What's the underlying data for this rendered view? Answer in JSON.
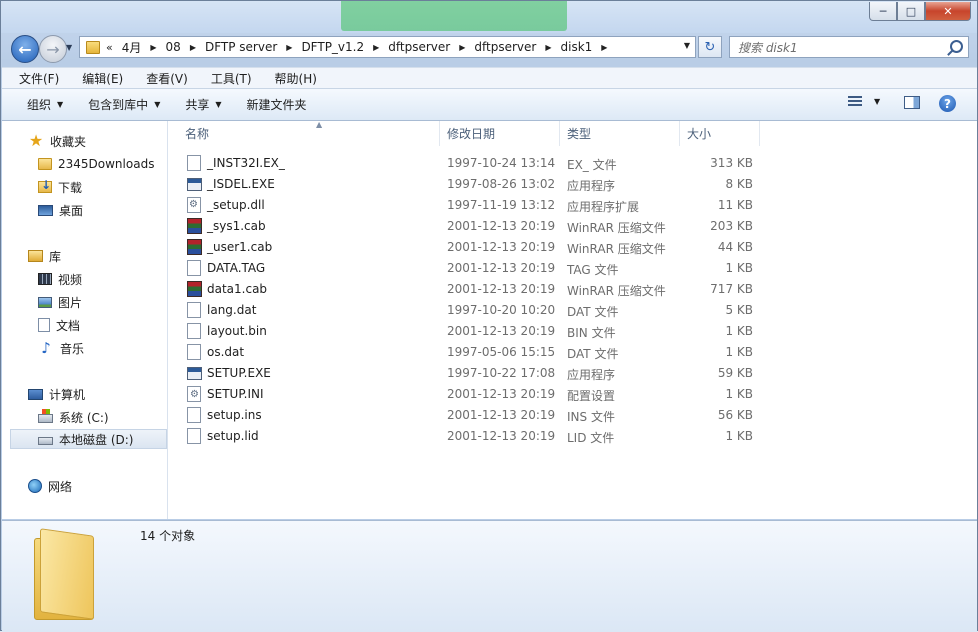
{
  "window": {
    "controls": {
      "minimize": "─",
      "maximize": "□",
      "close": "✕"
    }
  },
  "nav": {
    "breadcrumb": [
      "«",
      "4月",
      "08",
      "DFTP server",
      "DFTP_v1.2",
      "dftpserver",
      "dftpserver",
      "disk1"
    ],
    "search_placeholder": "搜索 disk1"
  },
  "menu": [
    "文件(F)",
    "编辑(E)",
    "查看(V)",
    "工具(T)",
    "帮助(H)"
  ],
  "commands": [
    {
      "label": "组织",
      "dropdown": true
    },
    {
      "label": "包含到库中",
      "dropdown": true
    },
    {
      "label": "共享",
      "dropdown": true
    },
    {
      "label": "新建文件夹",
      "dropdown": false
    }
  ],
  "sidebar": {
    "favorites": {
      "label": "收藏夹",
      "items": [
        "2345Downloads",
        "下载",
        "桌面"
      ]
    },
    "libraries": {
      "label": "库",
      "items": [
        "视频",
        "图片",
        "文档",
        "音乐"
      ]
    },
    "computer": {
      "label": "计算机",
      "items": [
        "系统 (C:)",
        "本地磁盘 (D:)"
      ],
      "selected": "本地磁盘 (D:)"
    },
    "network": {
      "label": "网络"
    }
  },
  "columns": {
    "name": "名称",
    "date": "修改日期",
    "type": "类型",
    "size": "大小"
  },
  "files": [
    {
      "name": "_INST32I.EX_",
      "date": "1997-10-24 13:14",
      "type": "EX_ 文件",
      "size": "313 KB",
      "icon": "generic"
    },
    {
      "name": "_ISDEL.EXE",
      "date": "1997-08-26 13:02",
      "type": "应用程序",
      "size": "8 KB",
      "icon": "exe"
    },
    {
      "name": "_setup.dll",
      "date": "1997-11-19 13:12",
      "type": "应用程序扩展",
      "size": "11 KB",
      "icon": "dll"
    },
    {
      "name": "_sys1.cab",
      "date": "2001-12-13 20:19",
      "type": "WinRAR 压缩文件",
      "size": "203 KB",
      "icon": "rar"
    },
    {
      "name": "_user1.cab",
      "date": "2001-12-13 20:19",
      "type": "WinRAR 压缩文件",
      "size": "44 KB",
      "icon": "rar"
    },
    {
      "name": "DATA.TAG",
      "date": "2001-12-13 20:19",
      "type": "TAG 文件",
      "size": "1 KB",
      "icon": "generic"
    },
    {
      "name": "data1.cab",
      "date": "2001-12-13 20:19",
      "type": "WinRAR 压缩文件",
      "size": "717 KB",
      "icon": "rar"
    },
    {
      "name": "lang.dat",
      "date": "1997-10-20 10:20",
      "type": "DAT 文件",
      "size": "5 KB",
      "icon": "generic"
    },
    {
      "name": "layout.bin",
      "date": "2001-12-13 20:19",
      "type": "BIN 文件",
      "size": "1 KB",
      "icon": "generic"
    },
    {
      "name": "os.dat",
      "date": "1997-05-06 15:15",
      "type": "DAT 文件",
      "size": "1 KB",
      "icon": "generic"
    },
    {
      "name": "SETUP.EXE",
      "date": "1997-10-22 17:08",
      "type": "应用程序",
      "size": "59 KB",
      "icon": "exe"
    },
    {
      "name": "SETUP.INI",
      "date": "2001-12-13 20:19",
      "type": "配置设置",
      "size": "1 KB",
      "icon": "ini"
    },
    {
      "name": "setup.ins",
      "date": "2001-12-13 20:19",
      "type": "INS 文件",
      "size": "56 KB",
      "icon": "generic"
    },
    {
      "name": "setup.lid",
      "date": "2001-12-13 20:19",
      "type": "LID 文件",
      "size": "1 KB",
      "icon": "generic"
    }
  ],
  "details": {
    "count": "14 个对象"
  }
}
